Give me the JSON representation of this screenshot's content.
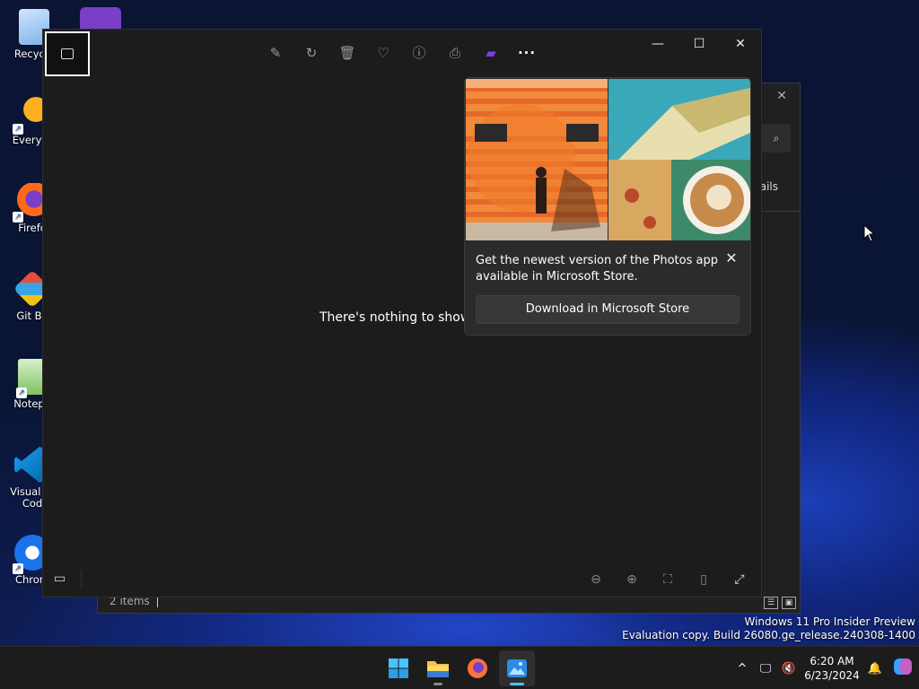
{
  "desktop": {
    "icons": [
      {
        "label": "Recycle",
        "icon": "recycle-bin-icon"
      },
      {
        "label": "Everyth",
        "icon": "everything-search-icon"
      },
      {
        "label": "Firefo",
        "icon": "firefox-icon"
      },
      {
        "label": "Git Ba",
        "icon": "git-bash-icon"
      },
      {
        "label": "Notepa",
        "icon": "notepad-icon"
      },
      {
        "label": "Visual St Cod",
        "icon": "vscode-icon"
      },
      {
        "label": "Chrom",
        "icon": "chrome-icon"
      }
    ]
  },
  "explorer": {
    "details_tab": "ails",
    "status_items": "2 items"
  },
  "photos": {
    "empty_message": "There's nothing to show he",
    "toolbar": [
      "edit-icon",
      "rotate-icon",
      "delete-icon",
      "favorite-icon",
      "info-icon",
      "print-icon",
      "clipchamp-icon",
      "more-icon"
    ],
    "window_controls": [
      "minimize",
      "maximize",
      "close"
    ]
  },
  "flyout": {
    "message": "Get the newest version of the Photos app available in Microsoft Store.",
    "button_label": "Download in Microsoft Store"
  },
  "watermark": {
    "line1": "Windows 11 Pro Insider Preview",
    "line2": "Evaluation copy. Build 26080.ge_release.240308-1400"
  },
  "taskbar": {
    "apps": [
      "start-icon",
      "file-explorer-icon",
      "firefox-icon",
      "photos-icon"
    ],
    "time": "6:20 AM",
    "date": "6/23/2024"
  },
  "colors": {
    "accent": "#4cc2ff",
    "window_bg": "#1c1c1c",
    "flyout_bg": "#2b2b2b"
  }
}
